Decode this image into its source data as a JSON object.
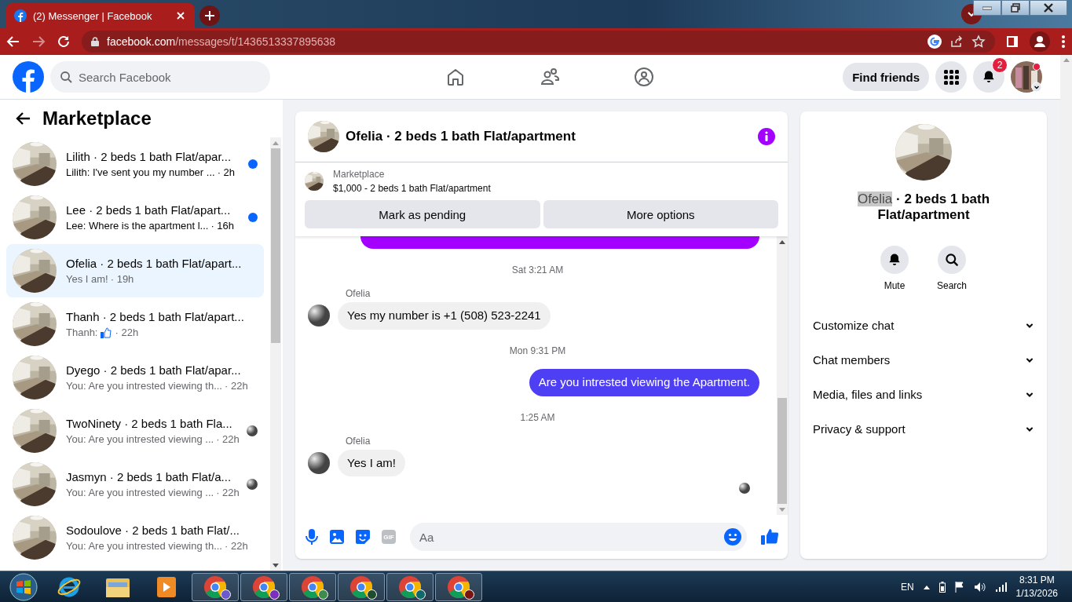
{
  "browser": {
    "tab_title": "(2) Messenger | Facebook",
    "url_domain": "facebook.com",
    "url_path": "/messages/t/1436513337895638"
  },
  "header": {
    "search_placeholder": "Search Facebook",
    "find_friends": "Find friends",
    "notification_count": "2"
  },
  "sidebar": {
    "title": "Marketplace",
    "conversations": [
      {
        "title": "Lilith · 2 beds 1 bath Flat/apar...",
        "preview": "Lilith: I've sent you my number ...",
        "time": "· 2h",
        "unread": true,
        "seen_avatar": false,
        "selected": false
      },
      {
        "title": "Lee · 2 beds 1 bath Flat/apart...",
        "preview": "Lee: Where is the apartment l...",
        "time": "· 16h",
        "unread": true,
        "seen_avatar": false,
        "selected": false
      },
      {
        "title": "Ofelia · 2 beds 1 bath Flat/apart...",
        "preview": "Yes I am!",
        "time": "· 19h",
        "unread": false,
        "seen_avatar": false,
        "selected": true
      },
      {
        "title": "Thanh · 2 beds 1 bath Flat/apart...",
        "preview": "Thanh:",
        "kind": "like-preview",
        "time": "· 22h",
        "unread": false,
        "seen_avatar": false,
        "selected": false
      },
      {
        "title": "Dyego · 2 beds 1 bath Flat/apar...",
        "preview": "You: Are you intrested viewing th...",
        "time": "· 22h",
        "unread": false,
        "seen_avatar": false,
        "selected": false
      },
      {
        "title": "TwoNinety · 2 beds 1 bath Fla...",
        "preview": "You: Are you intrested viewing ...",
        "time": "· 22h",
        "unread": false,
        "seen_avatar": true,
        "selected": false
      },
      {
        "title": "Jasmyn · 2 beds 1 bath Flat/a...",
        "preview": "You: Are you intrested viewing ...",
        "time": "· 22h",
        "unread": false,
        "seen_avatar": true,
        "selected": false
      },
      {
        "title": "Sodoulove · 2 beds 1 bath Flat/...",
        "preview": "You: Are you intrested viewing th...",
        "time": "· 22h",
        "unread": false,
        "seen_avatar": false,
        "selected": false
      }
    ]
  },
  "chat": {
    "title": "Ofelia · 2 beds 1 bath Flat/apartment",
    "listing": {
      "source": "Marketplace",
      "summary": "$1,000 - 2 beds 1 bath Flat/apartment"
    },
    "buttons": [
      "Mark as pending",
      "More options"
    ],
    "messages": [
      {
        "kind": "cut-outgoing"
      },
      {
        "kind": "timestamp",
        "text": "Sat 3:21 AM"
      },
      {
        "kind": "incoming",
        "sender": "Ofelia",
        "text": "Yes my number is +1 (508) 523-2241"
      },
      {
        "kind": "timestamp",
        "text": "Mon 9:31 PM"
      },
      {
        "kind": "outgoing",
        "text": "Are you intrested viewing the Apartment."
      },
      {
        "kind": "timestamp",
        "text": "1:25 AM"
      },
      {
        "kind": "incoming",
        "sender": "Ofelia",
        "text": "Yes I am!"
      }
    ],
    "seen_avatar": true,
    "composer": {
      "placeholder": "Aa",
      "gif_label": "GIF"
    }
  },
  "details": {
    "name_part": "Ofelia",
    "name_highlighted": true,
    "title_rest": "· 2 beds 1 bath Flat/apartment",
    "actions": [
      {
        "label": "Mute"
      },
      {
        "label": "Search"
      }
    ],
    "sections": [
      {
        "label": "Customize chat",
        "expanded": false
      },
      {
        "label": "Chat members",
        "expanded": false
      },
      {
        "label": "Media, files and links",
        "expanded": false
      },
      {
        "label": "Privacy & support",
        "expanded": false
      }
    ]
  },
  "taskbar": {
    "language": "EN",
    "time": "8:31 PM",
    "date": "1/13/2026",
    "apps": [
      {
        "kind": "ie"
      },
      {
        "kind": "explorer"
      },
      {
        "kind": "media"
      },
      {
        "kind": "chrome",
        "color": "#6a5acd"
      },
      {
        "kind": "chrome",
        "color": "#7b2fbe"
      },
      {
        "kind": "chrome",
        "color": "#3c8c4a"
      },
      {
        "kind": "chrome",
        "color": "#1e4d2b"
      },
      {
        "kind": "chrome",
        "color": "#0f6b6b"
      },
      {
        "kind": "chrome",
        "color": "#7a1414"
      }
    ]
  }
}
